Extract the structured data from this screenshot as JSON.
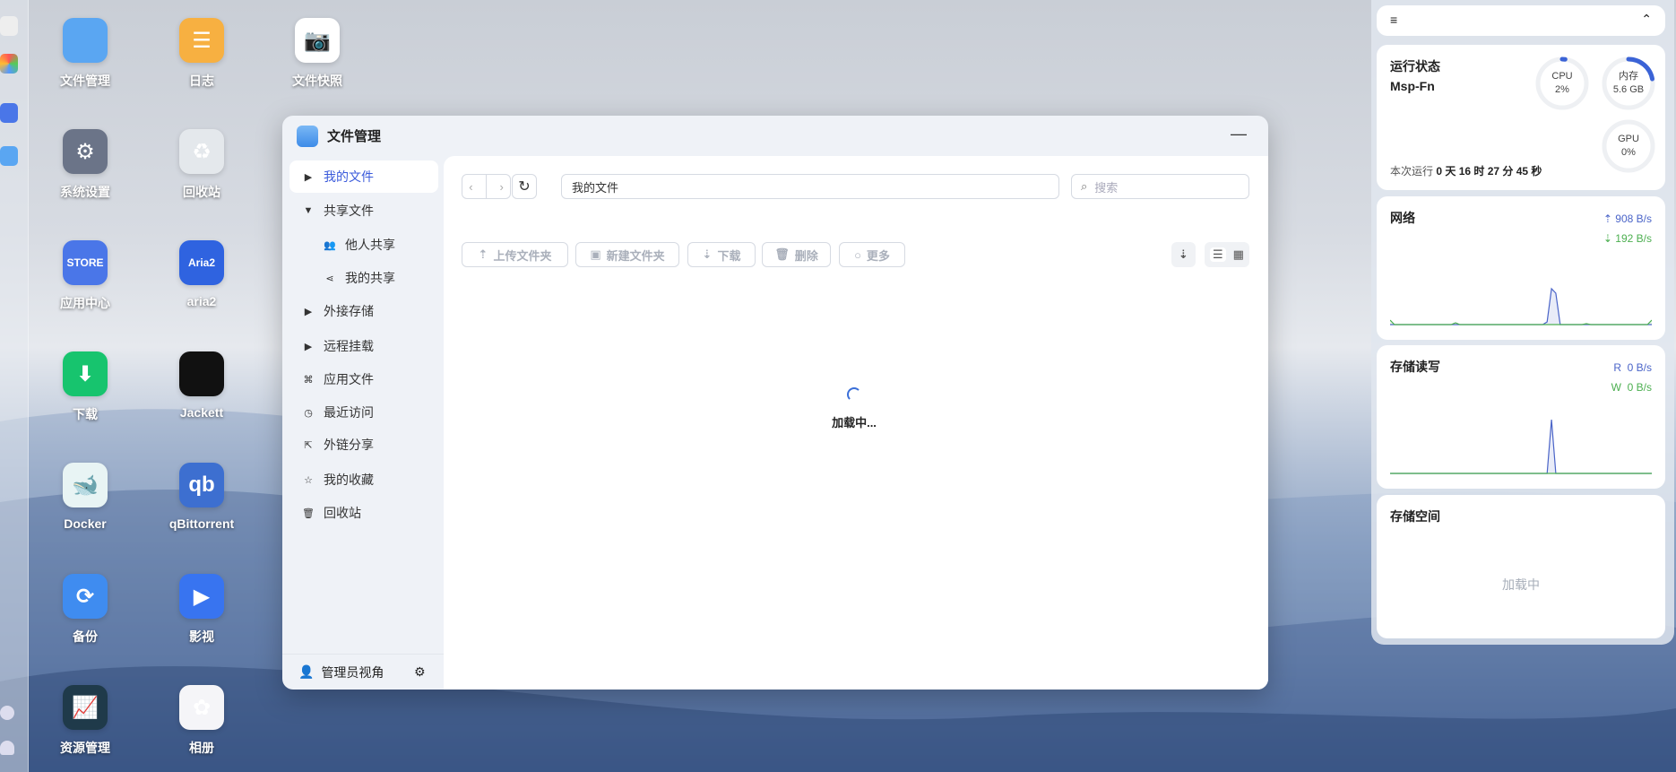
{
  "desktop": {
    "apps": [
      {
        "label": "文件管理",
        "icon": "folder-icon",
        "color": "#5aa6f2",
        "glyph": ""
      },
      {
        "label": "日志",
        "icon": "notes-icon",
        "color": "#f7b041",
        "glyph": "☰"
      },
      {
        "label": "文件快照",
        "icon": "file-snapshot-icon",
        "color": "#ffffff",
        "glyph": "📷"
      },
      {
        "label": "系统设置",
        "icon": "gear-icon",
        "color": "#6b7488",
        "glyph": "⚙"
      },
      {
        "label": "回收站",
        "icon": "recycle-icon",
        "color": "#e4e8ec",
        "glyph": "♻"
      },
      {
        "label": "应用中心",
        "icon": "store-icon",
        "color": "#4a76e8",
        "glyph": "STORE"
      },
      {
        "label": "aria2",
        "icon": "aria2-icon",
        "color": "#2f63e0",
        "glyph": "Aria2"
      },
      {
        "label": "下载",
        "icon": "download-icon",
        "color": "#17c46e",
        "glyph": "⬇"
      },
      {
        "label": "Jackett",
        "icon": "jacket-icon",
        "color": "#111111",
        "glyph": ""
      },
      {
        "label": "Docker",
        "icon": "docker-icon",
        "color": "#e8f4f4",
        "glyph": "🐋"
      },
      {
        "label": "qBittorrent",
        "icon": "qbittorrent-icon",
        "color": "#3d6fd0",
        "glyph": "qb"
      },
      {
        "label": "备份",
        "icon": "backup-icon",
        "color": "#3f8cf0",
        "glyph": "⟳"
      },
      {
        "label": "影视",
        "icon": "video-icon",
        "color": "#3874f0",
        "glyph": "▶"
      },
      {
        "label": "资源管理",
        "icon": "resource-monitor-icon",
        "color": "#1f3a4a",
        "glyph": "📈"
      },
      {
        "label": "相册",
        "icon": "photos-icon",
        "color": "#f5f5f8",
        "glyph": "✿"
      }
    ]
  },
  "window": {
    "title": "文件管理",
    "sidebar": {
      "items": [
        {
          "label": "我的文件",
          "icon": "caret-right-icon",
          "glyph": "▶"
        },
        {
          "label": "共享文件",
          "icon": "caret-down-icon",
          "glyph": "▼"
        },
        {
          "label": "他人共享",
          "icon": "users-icon",
          "glyph": "👥"
        },
        {
          "label": "我的共享",
          "icon": "share-icon",
          "glyph": "⋖"
        },
        {
          "label": "外接存储",
          "icon": "caret-right-icon",
          "glyph": "▶"
        },
        {
          "label": "远程挂载",
          "icon": "caret-right-icon",
          "glyph": "▶"
        },
        {
          "label": "应用文件",
          "icon": "apps-icon",
          "glyph": "⌘"
        },
        {
          "label": "最近访问",
          "icon": "clock-icon",
          "glyph": "◷"
        },
        {
          "label": "外链分享",
          "icon": "external-share-icon",
          "glyph": "⇱"
        },
        {
          "label": "我的收藏",
          "icon": "star-icon",
          "glyph": "☆"
        },
        {
          "label": "回收站",
          "icon": "trash-icon",
          "glyph": "🗑"
        }
      ],
      "admin_view": "管理员视角"
    },
    "path": "我的文件",
    "search_placeholder": "搜索",
    "toolbar": {
      "upload": "上传文件夹",
      "new_folder": "新建文件夹",
      "download": "下载",
      "delete": "删除",
      "more": "更多"
    },
    "loading": "加载中..."
  },
  "widgets": {
    "status": {
      "title": "运行状态",
      "host": "Msp-Fn",
      "uptime_label": "本次运行",
      "uptime": "0 天 16 时 27 分 45 秒",
      "cpu": {
        "label": "CPU",
        "value": "2%",
        "fraction": 0.02
      },
      "memory": {
        "label": "内存",
        "value": "5.6 GB",
        "fraction": 0.22
      },
      "gpu": {
        "label": "GPU",
        "value": "0%",
        "fraction": 0
      }
    },
    "network": {
      "title": "网络",
      "up": "908 B/s",
      "down": "192 B/s"
    },
    "disk_io": {
      "title": "存储读写",
      "read": "R  0 B/s",
      "write": "W  0 B/s"
    },
    "storage": {
      "title": "存储空间",
      "loading": "加载中"
    }
  },
  "chart_data": [
    {
      "type": "line",
      "title": "网络",
      "series": [
        {
          "name": "upload",
          "color": "#4a64c8",
          "values": [
            0,
            0,
            0,
            0,
            0,
            0,
            0,
            0,
            0,
            0,
            0,
            0,
            0,
            0,
            0,
            0,
            0,
            0,
            0,
            0,
            0,
            0,
            0,
            0,
            0,
            0,
            0,
            0,
            0,
            0,
            0,
            0,
            0,
            0,
            0,
            0,
            3,
            40,
            35,
            0,
            0,
            0,
            0,
            0,
            0,
            0,
            0,
            0,
            0,
            0,
            0,
            0,
            0,
            0,
            0,
            0,
            0,
            0,
            0,
            0,
            0
          ]
        },
        {
          "name": "download",
          "color": "#4caf50",
          "values": [
            5,
            0,
            0,
            0,
            0,
            0,
            0,
            0,
            0,
            0,
            0,
            0,
            0,
            0,
            0,
            2,
            0,
            0,
            0,
            0,
            0,
            0,
            0,
            0,
            0,
            0,
            0,
            0,
            0,
            0,
            0,
            0,
            0,
            0,
            0,
            0,
            0,
            0,
            0,
            0,
            0,
            0,
            0,
            0,
            0,
            1,
            0,
            0,
            0,
            0,
            0,
            0,
            0,
            0,
            0,
            0,
            0,
            0,
            0,
            0,
            5
          ]
        }
      ]
    },
    {
      "type": "line",
      "title": "存储读写",
      "series": [
        {
          "name": "read",
          "color": "#4a64c8",
          "values": [
            0,
            0,
            0,
            0,
            0,
            0,
            0,
            0,
            0,
            0,
            0,
            0,
            0,
            0,
            0,
            0,
            0,
            0,
            0,
            0,
            0,
            0,
            0,
            0,
            0,
            0,
            0,
            0,
            0,
            0,
            0,
            0,
            0,
            0,
            0,
            0,
            0,
            60,
            0,
            0,
            0,
            0,
            0,
            0,
            0,
            0,
            0,
            0,
            0,
            0,
            0,
            0,
            0,
            0,
            0,
            0,
            0,
            0,
            0,
            0,
            0
          ]
        },
        {
          "name": "write",
          "color": "#4caf50",
          "values": [
            0,
            0,
            0,
            0,
            0,
            0,
            0,
            0,
            0,
            0,
            0,
            0,
            0,
            0,
            0,
            0,
            0,
            0,
            0,
            0,
            0,
            0,
            0,
            0,
            0,
            0,
            0,
            0,
            0,
            0,
            0,
            0,
            0,
            0,
            0,
            0,
            0,
            0,
            0,
            0,
            0,
            0,
            0,
            0,
            0,
            0,
            0,
            0,
            0,
            0,
            0,
            0,
            0,
            0,
            0,
            0,
            0,
            0,
            0,
            0,
            0
          ]
        }
      ]
    }
  ]
}
